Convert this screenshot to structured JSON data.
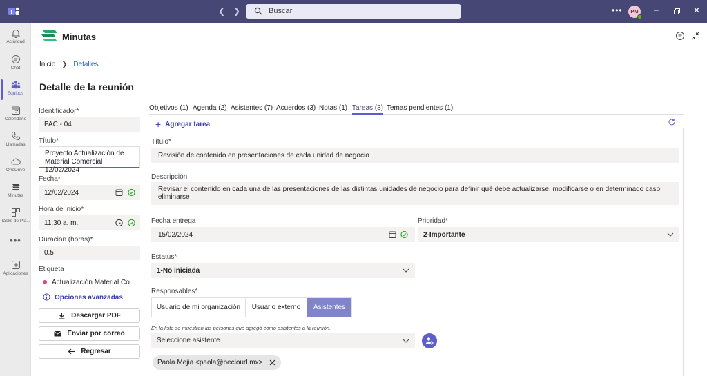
{
  "titlebar": {
    "search_placeholder": "Buscar",
    "avatar_initials": "PM",
    "presence_color": "#6bb700",
    "bg_color": "#464775"
  },
  "rail": {
    "items": [
      {
        "label": "Actividad",
        "icon": "bell-icon"
      },
      {
        "label": "Chat",
        "icon": "chat-icon"
      },
      {
        "label": "Equipos",
        "icon": "teams-icon",
        "active": true
      },
      {
        "label": "Calendario",
        "icon": "calendar-icon"
      },
      {
        "label": "Llamadas",
        "icon": "phone-icon"
      },
      {
        "label": "OneDrive",
        "icon": "cloud-icon"
      },
      {
        "label": "Minutas",
        "icon": "minutas-icon"
      },
      {
        "label": "Tasks de Pla...",
        "icon": "tasks-icon"
      }
    ],
    "more": "•••",
    "apps_label": "Aplicaciones"
  },
  "app": {
    "title": "Minutas",
    "accent_color": "#5b5fc7"
  },
  "breadcrumb": {
    "home": "Inicio",
    "current": "Detalles"
  },
  "page_title": "Detalle de la reunión",
  "left_form": {
    "identificador_label": "Identificador*",
    "identificador_value": "PAC - 04",
    "titulo_label": "Título*",
    "titulo_value_line1": "Proyecto Actualización de",
    "titulo_value_line2": "Material Comercial 12/02/2024",
    "fecha_label": "Fecha*",
    "fecha_value": "12/02/2024",
    "hora_label": "Hora de inicio*",
    "hora_value": "11:30 a. m.",
    "duracion_label": "Duración (horas)*",
    "duracion_value": "0.5",
    "etiqueta_label": "Etiqueta",
    "etiqueta_value": "Actualización Material Co...",
    "etiqueta_color": "#e0457b",
    "advanced_link": "Opciones avanzadas"
  },
  "actions": {
    "download_pdf": "Descargar PDF",
    "send_email": "Enviar por correo",
    "back": "Regresar"
  },
  "tabs": [
    {
      "label": "Objetivos (1)"
    },
    {
      "label": "Agenda (2)"
    },
    {
      "label": "Asistentes (7)"
    },
    {
      "label": "Acuerdos (3)"
    },
    {
      "label": "Notas (1)"
    },
    {
      "label": "Tareas (3)",
      "active": true
    },
    {
      "label": "Temas pendientes (1)"
    }
  ],
  "task_panel": {
    "add_task": "Agregar tarea",
    "titulo_label": "Título*",
    "titulo_value": "Revisión de contenido en presentaciones de cada unidad de negocio",
    "descripcion_label": "Descripción",
    "descripcion_value": "Revisar el contenido en cada una de las presentaciones de las distintas unidades de negocio para definir qué debe actualizarse, modificarse o en determinado caso eliminarse",
    "fecha_entrega_label": "Fecha entrega",
    "fecha_entrega_value": "15/02/2024",
    "prioridad_label": "Prioridad*",
    "prioridad_value": "2-Importante",
    "estatus_label": "Estatus*",
    "estatus_value": "1-No iniciada",
    "responsables_label": "Responsables*",
    "responsables_options": [
      "Usuario de mi organización",
      "Usuario externo",
      "Asistentes"
    ],
    "responsables_selected": "Asistentes",
    "hint": "En la lista se muestran las personas que agregó como asistentes a la reunión.",
    "select_placeholder": "Seleccione asistente",
    "assigned_chip": "Paola Mejia <paola@becloud.mx>"
  }
}
